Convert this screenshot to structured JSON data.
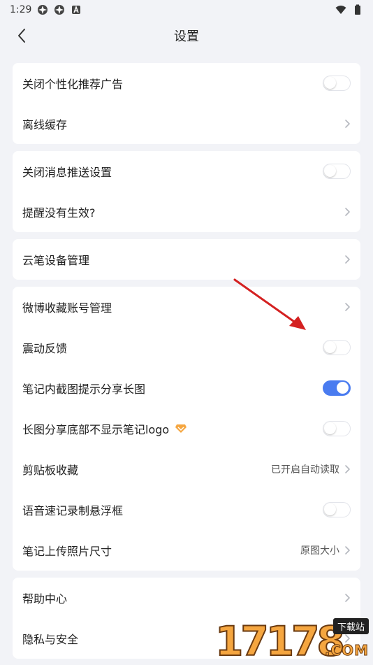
{
  "status_bar": {
    "time": "1:29"
  },
  "header": {
    "title": "设置"
  },
  "groups": [
    {
      "items": [
        {
          "label": "关闭个性化推荐广告",
          "control": "toggle",
          "on": false
        },
        {
          "label": "离线缓存",
          "control": "chevron"
        }
      ]
    },
    {
      "items": [
        {
          "label": "关闭消息推送设置",
          "control": "toggle",
          "on": false
        },
        {
          "label": "提醒没有生效?",
          "control": "chevron"
        }
      ]
    },
    {
      "items": [
        {
          "label": "云笔设备管理",
          "control": "chevron"
        }
      ]
    },
    {
      "items": [
        {
          "label": "微博收藏账号管理",
          "control": "chevron"
        },
        {
          "label": "震动反馈",
          "control": "toggle",
          "on": false
        },
        {
          "label": "笔记内截图提示分享长图",
          "control": "toggle",
          "on": true
        },
        {
          "label": "长图分享底部不显示笔记logo",
          "control": "toggle",
          "on": false,
          "badge": "vip-diamond-icon"
        },
        {
          "label": "剪贴板收藏",
          "control": "chevron",
          "value": "已开启自动读取"
        },
        {
          "label": "语音速记录制悬浮框",
          "control": "toggle",
          "on": false
        },
        {
          "label": "笔记上传照片尺寸",
          "control": "chevron",
          "value": "原图大小"
        }
      ]
    },
    {
      "items": [
        {
          "label": "帮助中心",
          "control": "chevron"
        },
        {
          "label": "隐私与安全",
          "control": "chevron"
        }
      ]
    }
  ],
  "watermark": {
    "digits": "17178",
    "tag": "下载站",
    "suffix": ".COM"
  },
  "colors": {
    "accent": "#4a7cf0",
    "background": "#f2f3f7",
    "arrow": "#d42020",
    "badge": "#f5a640"
  }
}
